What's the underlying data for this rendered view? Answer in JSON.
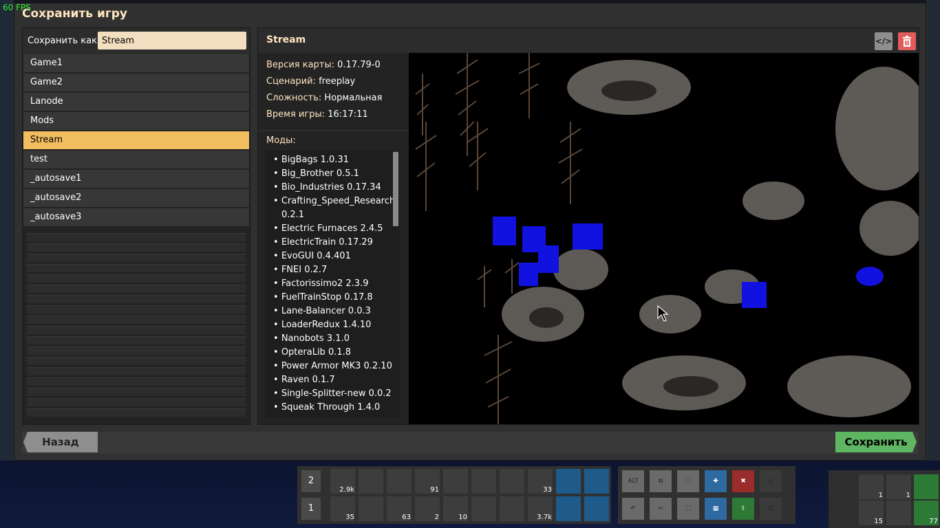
{
  "fps": "60 FPS",
  "dialog": {
    "title": "Сохранить игру",
    "save_as_label": "Сохранить как",
    "save_name_value": "Stream",
    "saves": [
      "Game1",
      "Game2",
      "Lanode",
      "Mods",
      "Stream",
      "test",
      "_autosave1",
      "_autosave2",
      "_autosave3"
    ],
    "selected_save": "Stream"
  },
  "preview": {
    "title": "Stream",
    "info": {
      "map_version_key": "Версия карты:",
      "map_version": "0.17.79-0",
      "scenario_key": "Сценарий:",
      "scenario": "freeplay",
      "difficulty_key": "Сложность:",
      "difficulty": "Нормальная",
      "playtime_key": "Время игры:",
      "playtime": "16:17:11"
    },
    "mods_label": "Моды:",
    "mods": [
      "BigBags 1.0.31",
      "Big_Brother 0.5.1",
      "Bio_Industries 0.17.34",
      "Crafting_Speed_Research 0.2.1",
      "Electric Furnaces 2.4.5",
      "ElectricTrain 0.17.29",
      "EvoGUI 0.4.401",
      "FNEI 0.2.7",
      "Factorissimo2 2.3.9",
      "FuelTrainStop 0.17.8",
      "Lane-Balancer 0.0.3",
      "LoaderRedux 1.4.10",
      "Nanobots 3.1.0",
      "OpteraLib 0.1.8",
      "Power Armor MK3 0.2.10",
      "Raven 0.1.7",
      "Single-Splitter-new 0.0.2",
      "Squeak Through 1.4.0"
    ]
  },
  "buttons": {
    "back": "Назад",
    "save": "Сохранить"
  },
  "quickbar": {
    "row2_label": "2",
    "row1_label": "1",
    "row2_counts": [
      "2.9k",
      "",
      "",
      "91",
      "",
      "",
      "",
      "33",
      "",
      ""
    ],
    "row1_counts": [
      "35",
      "",
      "63",
      "2",
      "10",
      "",
      "",
      "3.7k",
      "",
      ""
    ]
  },
  "shortcuts": {
    "alt_label": "ALT"
  },
  "weapons": {
    "counts": [
      "1",
      "1",
      "15",
      "77"
    ]
  }
}
